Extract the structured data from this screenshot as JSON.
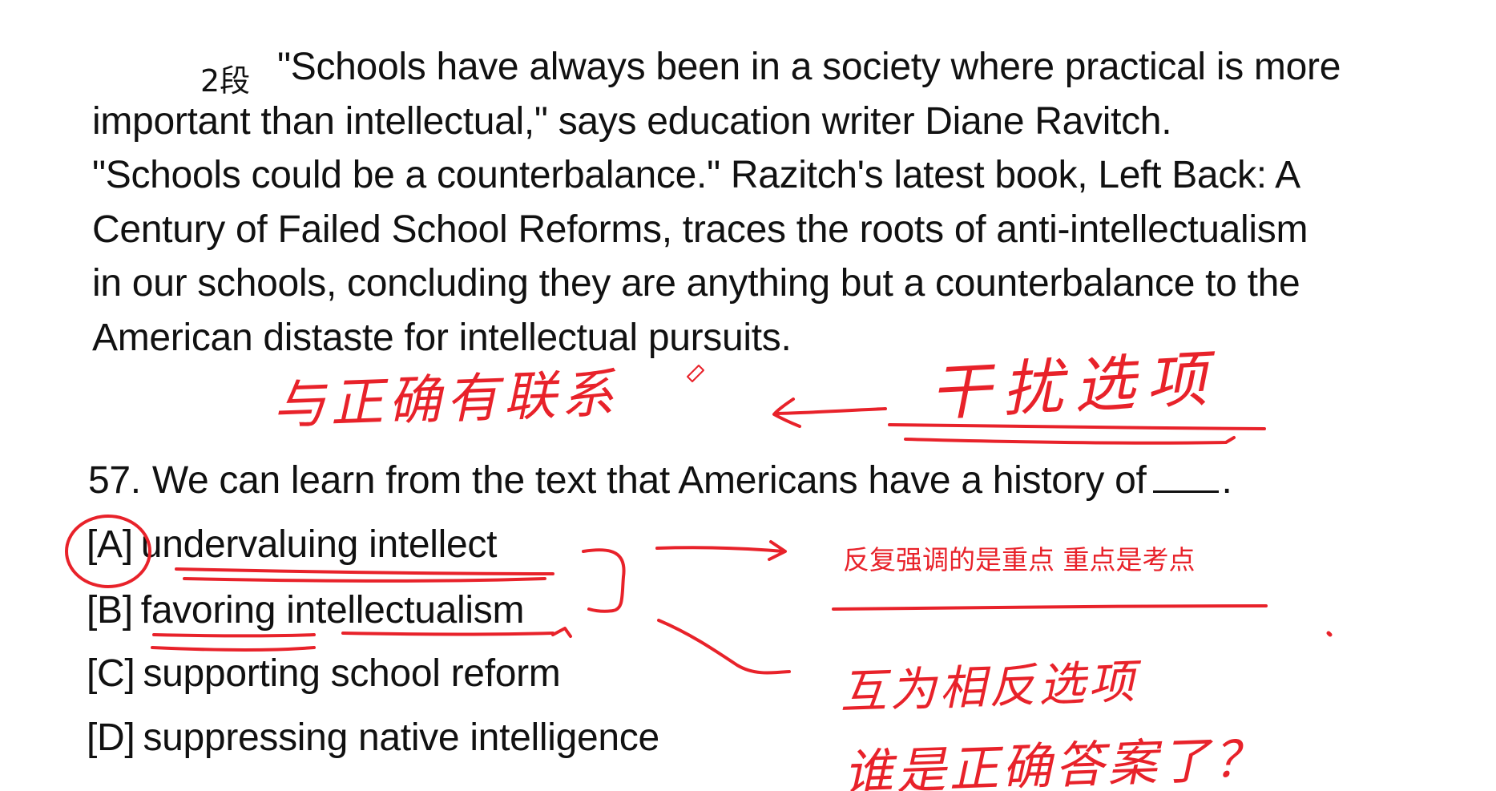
{
  "passage": {
    "label": "2段",
    "lines": [
      "\"Schools have always been in a society where practical is more",
      "important than intellectual,\" says education writer Diane Ravitch.",
      "\"Schools could be a counterbalance.\" Razitch's latest book, Left Back: A",
      "Century of Failed School Reforms, traces the roots of anti-intellectualism",
      "in our schools, concluding they are anything but a counterbalance to the",
      "American distaste for intellectual pursuits."
    ]
  },
  "question": {
    "number": "57.",
    "stem": "We can learn from the text that Americans have a history of",
    "end": "."
  },
  "options": [
    {
      "letter": "[A]",
      "text": "undervaluing intellect"
    },
    {
      "letter": "[B]",
      "text": "favoring intellectualism"
    },
    {
      "letter": "[C]",
      "text": "supporting school reform"
    },
    {
      "letter": "[D]",
      "text": "suppressing native intelligence"
    }
  ],
  "annotations": {
    "typed_note": "反复强调的是重点  重点是考点",
    "handwritten": {
      "related": "与正确有联系",
      "distractor": "干扰选项",
      "opposite": "互为相反选项",
      "which": "谁是正确答案了？"
    },
    "circled_option": "[A]",
    "ink_color": "#e8222a"
  }
}
